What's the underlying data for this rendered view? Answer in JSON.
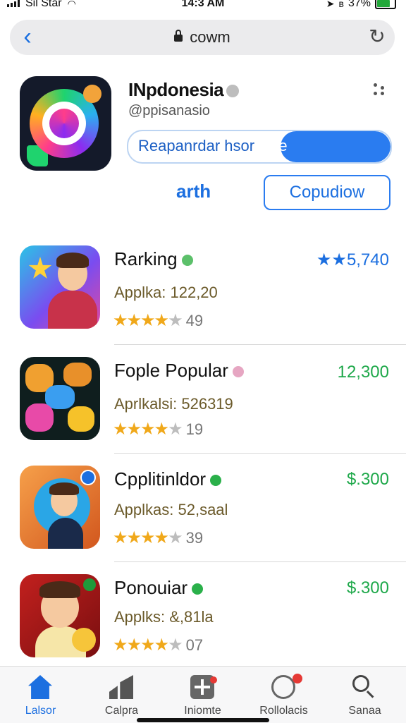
{
  "status_bar": {
    "carrier": "Sil Star",
    "time": "14:3 AM",
    "battery": "37%"
  },
  "browser": {
    "url": "cowm"
  },
  "featured": {
    "title": "INpdonesia",
    "subtitle": "@ppisanasio",
    "install_text_blue": "Reapanrdar hsor",
    "install_text_white": "asie",
    "link_label": "arth",
    "outline_button_label": "Copudiow"
  },
  "apps": [
    {
      "name": "Rarking",
      "meta": "Applka: 122,20",
      "stars": "★★★★",
      "half": "★",
      "count": "49",
      "price": "★★5,740",
      "price_style": "blue"
    },
    {
      "name": "Fople Popular",
      "meta": "Aprlkalsi: 526319",
      "stars": "★★★★",
      "half": "★",
      "count": "19",
      "price": "12,300",
      "price_style": "green"
    },
    {
      "name": "Cpplitinldor",
      "meta": "Applkas: 52,saal",
      "stars": "★★★★",
      "half": "★",
      "count": "39",
      "price": "$.300",
      "price_style": "green"
    },
    {
      "name": "Ponouiar",
      "meta": "Applks: &,81la",
      "stars": "★★★★",
      "half": "★",
      "count": "07",
      "price": "$.300",
      "price_style": "green"
    }
  ],
  "tabs": [
    {
      "label": "Lalsor",
      "icon": "home-icon"
    },
    {
      "label": "Calpra",
      "icon": "chart-icon"
    },
    {
      "label": "Iniomte",
      "icon": "add-icon"
    },
    {
      "label": "Rollolacis",
      "icon": "globe-icon"
    },
    {
      "label": "Sanaa",
      "icon": "search-icon"
    }
  ],
  "colors": {
    "accent": "#2a7cf0",
    "price_green": "#1ea84a",
    "star": "#f0a81a"
  }
}
